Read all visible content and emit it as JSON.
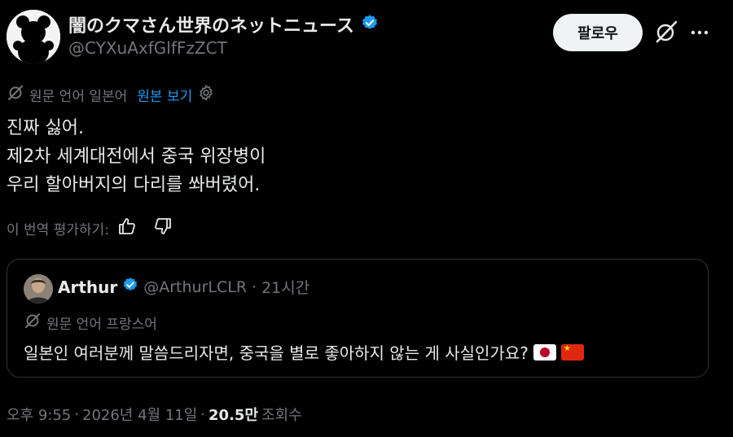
{
  "author": {
    "display_name": "闇のクマさん世界のネットニュース",
    "handle": "@CYXuAxfGlfFzZCT",
    "follow_label": "팔로우"
  },
  "translation": {
    "source_label": "원문 언어 일본어",
    "show_original_label": "원본 보기"
  },
  "tweet": {
    "text": "진짜 싫어.\n제2차 세계대전에서 중국 위장병이\n우리 할아버지의 다리를 쏴버렸어."
  },
  "rate_translation": {
    "label": "이 번역 평가하기:"
  },
  "quote": {
    "name": "Arthur",
    "handle": "@ArthurLCLR",
    "separator": "·",
    "time": "21시간",
    "source_label": "원문 언어 프랑스어",
    "text": "일본인 여러분께 말씀드리자면, 중국을 별로 좋아하지 않는 게 사실인가요?"
  },
  "footer": {
    "time": "오후 9:55",
    "sep1": "·",
    "date": "2026년 4월 11일",
    "sep2": "·",
    "views_count": "20.5만",
    "views_label": "조회수"
  },
  "colors": {
    "background": "#000000",
    "text_primary": "#e7e9ea",
    "text_secondary": "#71767b",
    "accent": "#1d9bf0",
    "border": "#2f3336"
  },
  "icons": [
    "verified-badge-icon",
    "grok-icon",
    "more-icon",
    "translate-icon",
    "gear-icon",
    "thumbs-up-icon",
    "thumbs-down-icon"
  ]
}
